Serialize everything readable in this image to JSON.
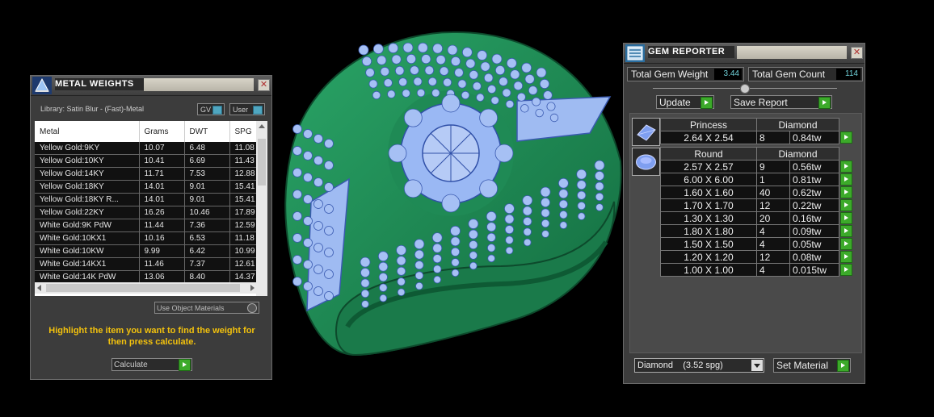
{
  "metal_panel": {
    "title": "METAL WEIGHTS",
    "library": "Library: Satin Blur - (Fast)-Metal",
    "toggle_gv": "GV",
    "toggle_user": "User",
    "columns": [
      "Metal",
      "Grams",
      "DWT",
      "SPG"
    ],
    "rows": [
      [
        "Yellow Gold:9KY",
        "10.07",
        "6.48",
        "11.08"
      ],
      [
        "Yellow Gold:10KY",
        "10.41",
        "6.69",
        "11.43"
      ],
      [
        "Yellow Gold:14KY",
        "11.71",
        "7.53",
        "12.88"
      ],
      [
        "Yellow Gold:18KY",
        "14.01",
        "9.01",
        "15.41"
      ],
      [
        "Yellow Gold:18KY R...",
        "14.01",
        "9.01",
        "15.41"
      ],
      [
        "Yellow Gold:22KY",
        "16.26",
        "10.46",
        "17.89"
      ],
      [
        "White Gold:9K PdW",
        "11.44",
        "7.36",
        "12.59"
      ],
      [
        "White Gold:10KX1",
        "10.16",
        "6.53",
        "11.18"
      ],
      [
        "White Gold:10KW",
        "9.99",
        "6.42",
        "10.99"
      ],
      [
        "White Gold:14KX1",
        "11.46",
        "7.37",
        "12.61"
      ],
      [
        "White Gold:14K PdW",
        "13.06",
        "8.40",
        "14.37"
      ]
    ],
    "use_object_materials": "Use Object Materials",
    "hint": "Highlight the item you want to find the weight for then press calculate.",
    "calculate_label": "Calculate"
  },
  "gem_panel": {
    "title": "GEM REPORTER",
    "total_weight_label": "Total Gem Weight",
    "total_weight_value": "3.44",
    "total_count_label": "Total Gem Count",
    "total_count_value": "114",
    "update_label": "Update",
    "save_report_label": "Save Report",
    "princess": {
      "shape": "Princess",
      "material": "Diamond",
      "rows": [
        [
          "2.64 X 2.54",
          "8",
          "0.84tw"
        ]
      ]
    },
    "round": {
      "shape": "Round",
      "material": "Diamond",
      "rows": [
        [
          "2.57 X 2.57",
          "9",
          "0.56tw"
        ],
        [
          "6.00 X 6.00",
          "1",
          "0.81tw"
        ],
        [
          "1.60 X 1.60",
          "40",
          "0.62tw"
        ],
        [
          "1.70 X 1.70",
          "12",
          "0.22tw"
        ],
        [
          "1.30 X 1.30",
          "20",
          "0.16tw"
        ],
        [
          "1.80 X 1.80",
          "4",
          "0.09tw"
        ],
        [
          "1.50 X 1.50",
          "4",
          "0.05tw"
        ],
        [
          "1.20 X 1.20",
          "12",
          "0.08tw"
        ],
        [
          "1.00 X 1.00",
          "4",
          "0.015tw"
        ]
      ]
    },
    "material_select": "Diamond    (3.52 spg)",
    "set_material_label": "Set Material"
  },
  "colors": {
    "metal_green": "#1f8a55",
    "gem_blue": "#8fb2f0",
    "accent_green": "#3caa2a",
    "hint_yellow": "#f2c10d"
  }
}
